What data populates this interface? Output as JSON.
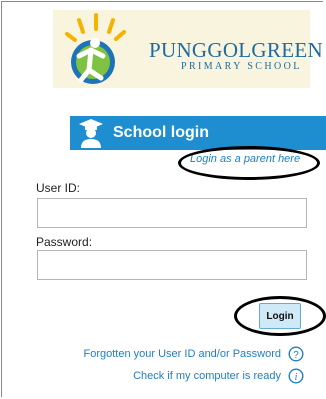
{
  "colors": {
    "brand_blue": "#1e8ed0",
    "link_blue": "#1e7fc4",
    "logo_bg": "#f8f4de"
  },
  "logo": {
    "name": "PUNGGOLGREEN",
    "subtitle": "PRIMARY SCHOOL",
    "icon": "runner-sun-logo"
  },
  "banner": {
    "icon": "graduate-user-icon",
    "title": "School login"
  },
  "parent_login": {
    "link": "Login as a parent here"
  },
  "form": {
    "user_id": {
      "label": "User ID:",
      "value": ""
    },
    "password": {
      "label": "Password:",
      "value": ""
    },
    "login_button": "Login"
  },
  "help": {
    "forgot": "Forgotten your User ID and/or Password",
    "forgot_icon": "question-circle-icon",
    "check": "Check if my computer is ready",
    "check_icon": "info-circle-icon"
  }
}
